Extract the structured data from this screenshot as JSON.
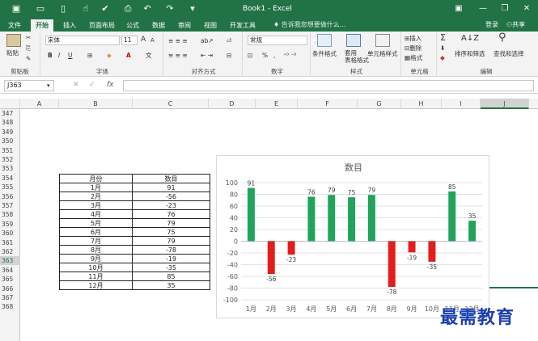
{
  "app": {
    "title": "Book1 - Excel",
    "quick_access": [
      "save-icon",
      "new-icon",
      "touch-icon",
      "spellcheck-icon",
      "preview-icon",
      "undo-icon",
      "redo-icon",
      "customize-icon"
    ]
  },
  "menu": {
    "tabs": [
      "文件",
      "开始",
      "插入",
      "页面布局",
      "公式",
      "数据",
      "审阅",
      "视图",
      "开发工具"
    ],
    "active_tab": "开始",
    "tell_me": "告诉我您想要做什么...",
    "login": "登录",
    "share": "共享"
  },
  "ribbon": {
    "clipboard": {
      "label": "剪贴板",
      "paste": "粘贴"
    },
    "font": {
      "label": "字体",
      "name": "宋体",
      "size": "11",
      "bold": "B",
      "italic": "I",
      "underline": "U",
      "grow": "A",
      "shrink": "A"
    },
    "alignment": {
      "label": "对齐方式"
    },
    "number": {
      "label": "数字",
      "format": "常规",
      "percent": "%",
      "comma": ","
    },
    "styles": {
      "label": "样式",
      "conditional": "条件格式",
      "table_format": "套用\n表格格式",
      "cell_styles": "单元格样式"
    },
    "cells": {
      "label": "单元格",
      "insert": "插入",
      "delete": "删除",
      "format": "格式"
    },
    "editing": {
      "label": "编辑",
      "sort_filter": "排序和筛选",
      "find_select": "查找和选择"
    }
  },
  "formula_bar": {
    "name_box": "J363",
    "fx": "fx",
    "cancel": "✕",
    "enter": "✓",
    "content": ""
  },
  "columns": [
    "A",
    "B",
    "C",
    "D",
    "E",
    "F",
    "G",
    "H",
    "I",
    "J"
  ],
  "selected_column": "J",
  "rows": [
    "347",
    "348",
    "349",
    "350",
    "351",
    "352",
    "353",
    "354",
    "355",
    "356",
    "357",
    "358",
    "359",
    "360",
    "361",
    "362",
    "363",
    "364",
    "365",
    "366",
    "367",
    "368"
  ],
  "selected_row": "363",
  "table": {
    "headers": [
      "月份",
      "数目"
    ],
    "rows": [
      [
        "1月",
        "91"
      ],
      [
        "2月",
        "-56"
      ],
      [
        "3月",
        "-23"
      ],
      [
        "4月",
        "76"
      ],
      [
        "5月",
        "79"
      ],
      [
        "6月",
        "75"
      ],
      [
        "7月",
        "79"
      ],
      [
        "8月",
        "-78"
      ],
      [
        "9月",
        "-19"
      ],
      [
        "10月",
        "-35"
      ],
      [
        "11月",
        "85"
      ],
      [
        "12月",
        "35"
      ]
    ]
  },
  "colors": {
    "excel_green": "#217346",
    "positive": "#21a35b",
    "negative": "#e31c1c"
  },
  "chart_data": {
    "type": "bar",
    "title": "数目",
    "categories": [
      "1月",
      "2月",
      "3月",
      "4月",
      "5月",
      "6月",
      "7月",
      "8月",
      "9月",
      "10月",
      "11月",
      "12月"
    ],
    "values": [
      91,
      -56,
      -23,
      76,
      79,
      75,
      79,
      -78,
      -19,
      -35,
      85,
      35
    ],
    "ylim": [
      -100,
      100
    ],
    "yticks": [
      -100,
      -80,
      -60,
      -40,
      -20,
      0,
      20,
      40,
      60,
      80,
      100
    ],
    "grid": true,
    "legend": "none"
  },
  "watermark": "最需教育"
}
